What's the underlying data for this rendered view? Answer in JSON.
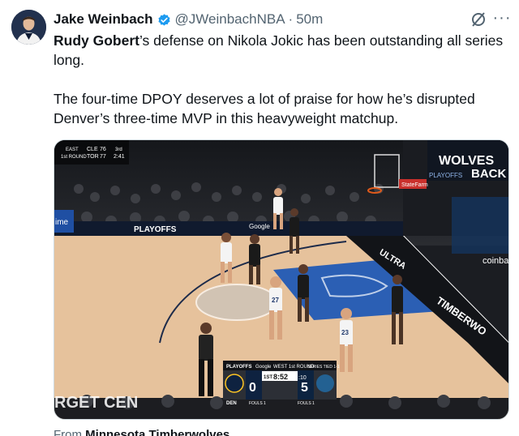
{
  "author": {
    "name": "Jake Weinbach",
    "handle": "@JWeinbachNBA",
    "separator": "·",
    "time": "50m"
  },
  "tweet": {
    "line1_bold": "Rudy Gobert",
    "line1_rest": "’s defense on Nikola Jokic has been outstanding all series long.",
    "paragraph2": "The four-time DPOY deserves a lot of praise for how he’s disrupted Denver’s three-time MVP in this heavyweight matchup."
  },
  "video": {
    "corner_score": {
      "label_left_1": "EAST",
      "label_left_2": "1st ROUND",
      "team_a": "CLE",
      "score_a": "76",
      "team_b": "TOR",
      "score_b": "77",
      "quarter": "3rd",
      "clock": "2:41"
    },
    "brand_overlay": {
      "line1": "WOLVES",
      "line2": "BACK",
      "sub": "PLAYOFFS"
    },
    "banner_playoffs": "PLAYOFFS",
    "banner_google": "Google",
    "courtside_ultra": "ULTRA",
    "courtside_timberwolves": "TIMBERWO",
    "coinbase": "coinba",
    "time_left_board": "ime",
    "statefarm": "StateFarm",
    "target_center": "RGET CEN",
    "jersey_front": "27",
    "jersey_right": "23",
    "scorebug": {
      "header_left": "PLAYOFFS",
      "header_google": "Google",
      "header_round": "WEST 1st ROUND",
      "header_series": "SERIES TIED 1-1",
      "period": "1ST",
      "clock": "8:52",
      "shot_clock": ":10",
      "home_score": "0",
      "away_score": "5",
      "home_abbr": "DEN",
      "home_fouls": "FOULS 1",
      "away_fouls": "FOULS 1"
    }
  },
  "footer": {
    "prefix": "From",
    "source": "Minnesota Timberwolves"
  },
  "colors": {
    "verified": "#1d9bf0",
    "court_blue": "#2b62b8",
    "court_wood": "#e7c6a1"
  }
}
